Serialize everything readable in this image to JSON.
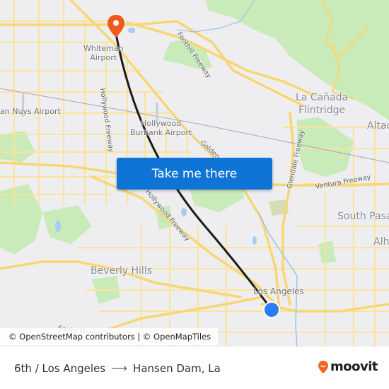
{
  "map": {
    "labels": {
      "whiteman_airport": "Whiteman\nAirport",
      "van_nuys_airport": "an Nuys Airport",
      "hollywood_burbank_airport": "Hollywood\nBurbank Airport",
      "la_canada_flintridge": "La Cañada\nFlintridge",
      "altadena": "Altad",
      "south_pasadena": "South Pasa",
      "alhambra": "Alh",
      "beverly_hills": "Beverly Hills",
      "los_angeles": "Los Angeles",
      "foothill_freeway": "Foothill Freeway",
      "hollywood_freeway_north": "Hollywood Freeway",
      "hollywood_freeway_south": "Hollywood Freeway",
      "golden_state": "Golden S",
      "glendale_freeway": "Glendale Freeway",
      "ventura_freeway": "Ventura Freeway",
      "santa_monica_freeway": "Santa Monica Freeway"
    },
    "colors": {
      "background": "#eeeef0",
      "park": "#c9ebb9",
      "road": "#fbe49a",
      "route": "#1c1c1c",
      "destination_pin": "#f05a1a",
      "origin_dot": "#2c7cf5"
    },
    "markers": {
      "destination_icon": "map-pin-icon",
      "origin_icon": "location-dot-icon"
    }
  },
  "cta": {
    "take_me_there_label": "Take me there",
    "color": "#0e74d6"
  },
  "attribution": {
    "text": "© OpenStreetMap contributors | © OpenMapTiles"
  },
  "footer": {
    "origin": "6th / Los Angeles",
    "arrow_icon": "arrow-right-icon",
    "destination": "Hansen Dam, La",
    "brand": "moovit",
    "brand_color": "#f26522"
  }
}
